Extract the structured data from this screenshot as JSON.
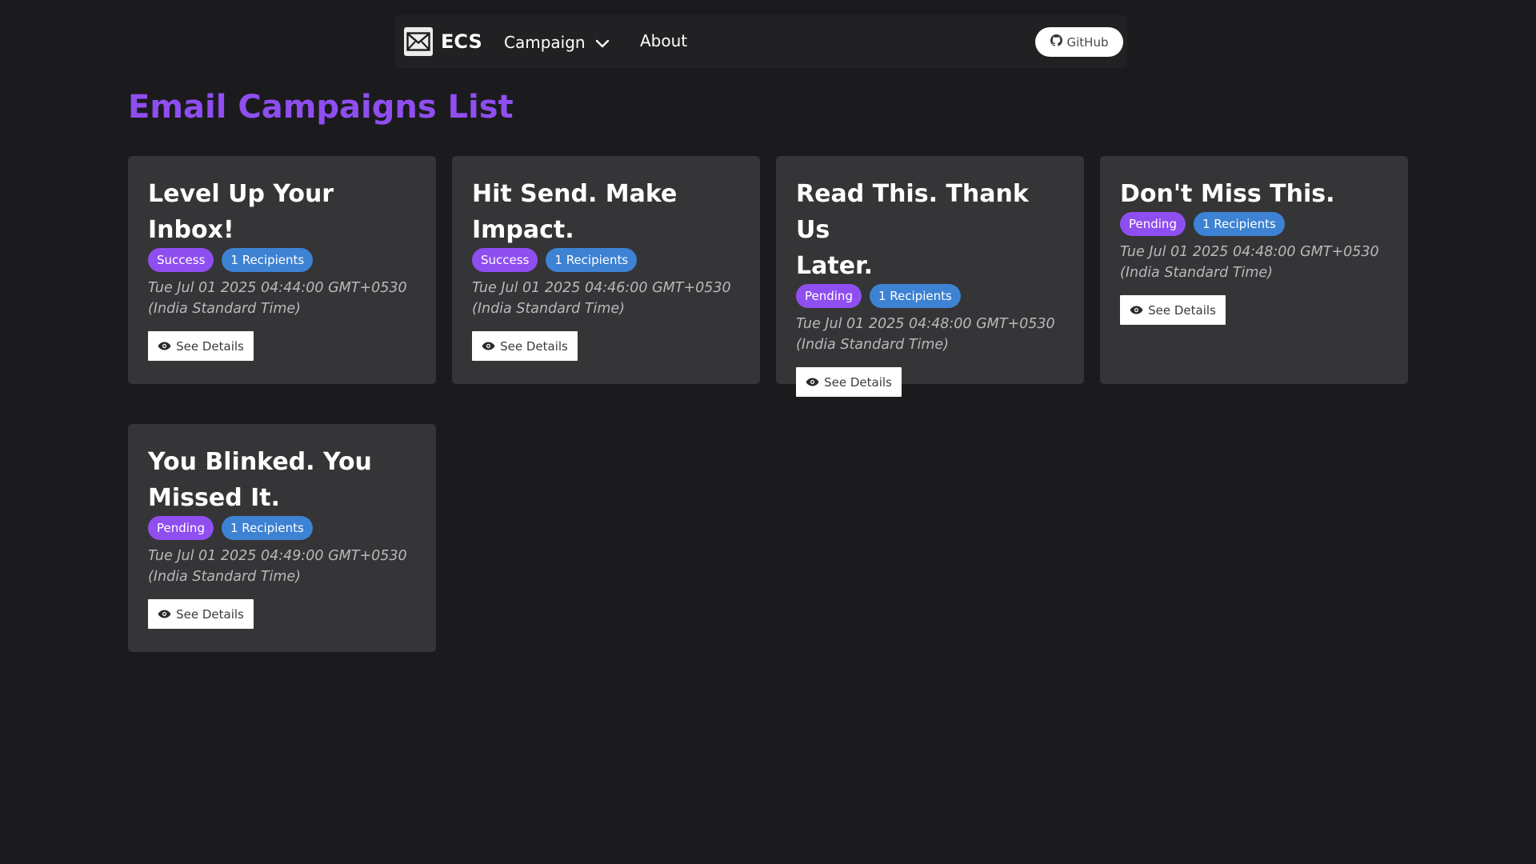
{
  "nav": {
    "brand": "ECS",
    "campaign_label": "Campaign",
    "about_label": "About",
    "github_label": "GitHub"
  },
  "page": {
    "title": "Email Campaigns List"
  },
  "campaigns": [
    {
      "title": "Level Up Your Inbox!",
      "status": "Success",
      "recipients": "1 Recipients",
      "date_line1": "Tue Jul 01 2025 04:44:00 GMT+0530",
      "date_line2": "(India Standard Time)",
      "button_label": "See Details"
    },
    {
      "title_line1": "Hit Send. Make",
      "title_line2": "Impact.",
      "status": "Success",
      "recipients": "1 Recipients",
      "date_line1": "Tue Jul 01 2025 04:46:00 GMT+0530",
      "date_line2": "(India Standard Time)",
      "button_label": "See Details"
    },
    {
      "title_line1": "Read This. Thank Us",
      "title_line2": "Later.",
      "status": "Pending",
      "recipients": "1 Recipients",
      "date_line1": "Tue Jul 01 2025 04:48:00 GMT+0530",
      "date_line2": "(India Standard Time)",
      "button_label": "See Details"
    },
    {
      "title": "Don't Miss This.",
      "status": "Pending",
      "recipients": "1 Recipients",
      "date_line1": "Tue Jul 01 2025 04:48:00 GMT+0530",
      "date_line2": "(India Standard Time)",
      "button_label": "See Details"
    },
    {
      "title_line1": "You Blinked. You",
      "title_line2": "Missed It.",
      "status": "Pending",
      "recipients": "1 Recipients",
      "date_line1": "Tue Jul 01 2025 04:49:00 GMT+0530",
      "date_line2": "(India Standard Time)",
      "button_label": "See Details"
    }
  ],
  "colors": {
    "background": "#1b1b1d",
    "navbar": "#212123",
    "card": "#353537",
    "accent_purple": "#8f4ef0",
    "accent_blue": "#3d82d3"
  },
  "icons": {
    "logo": "envelope-icon",
    "dropdown": "chevron-down-icon",
    "github": "github-icon",
    "details": "eye-icon"
  }
}
